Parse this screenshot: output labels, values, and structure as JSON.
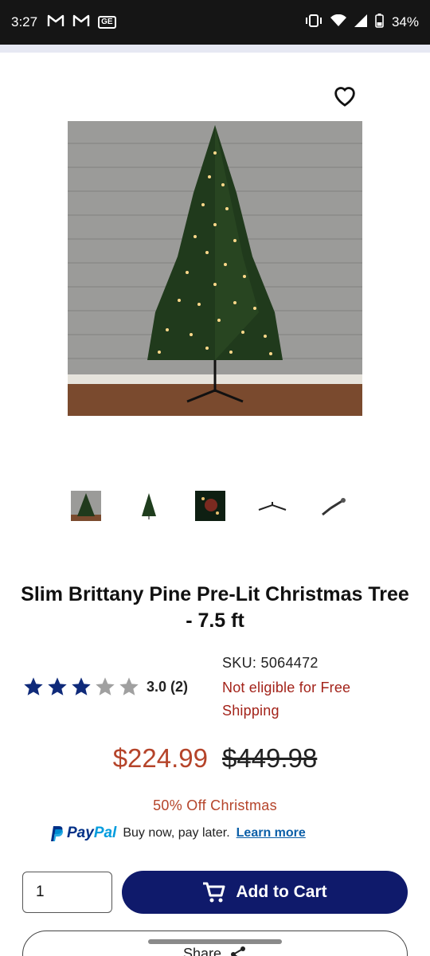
{
  "status_bar": {
    "time": "3:27",
    "battery": "34%",
    "icons": [
      "gmail-icon",
      "gmail-icon",
      "ge-icon",
      "vibrate-icon",
      "wifi-icon",
      "signal-icon",
      "battery-icon"
    ]
  },
  "product": {
    "title": "Slim Brittany Pine Pre-Lit Christmas Tree - 7.5 ft",
    "rating_value": "3.0",
    "rating_count": "(2)",
    "rating_stars": 3,
    "sku": "SKU: 5064472",
    "shipping_notice": "Not eligible for Free Shipping",
    "price": "$224.99",
    "original_price": "$449.98",
    "promo": "50% Off Christmas",
    "thumbnail_count": 5
  },
  "paypal": {
    "brand_pay": "Pay",
    "brand_pal": "Pal",
    "text": "Buy now, pay later.",
    "link": "Learn more"
  },
  "cart": {
    "quantity": "1",
    "add_label": "Add to Cart"
  },
  "share": {
    "label": "Share"
  },
  "colors": {
    "accent": "#0f1a6b",
    "sale": "#b5442a",
    "notice": "#a3231a",
    "star": "#0f2a7a"
  }
}
